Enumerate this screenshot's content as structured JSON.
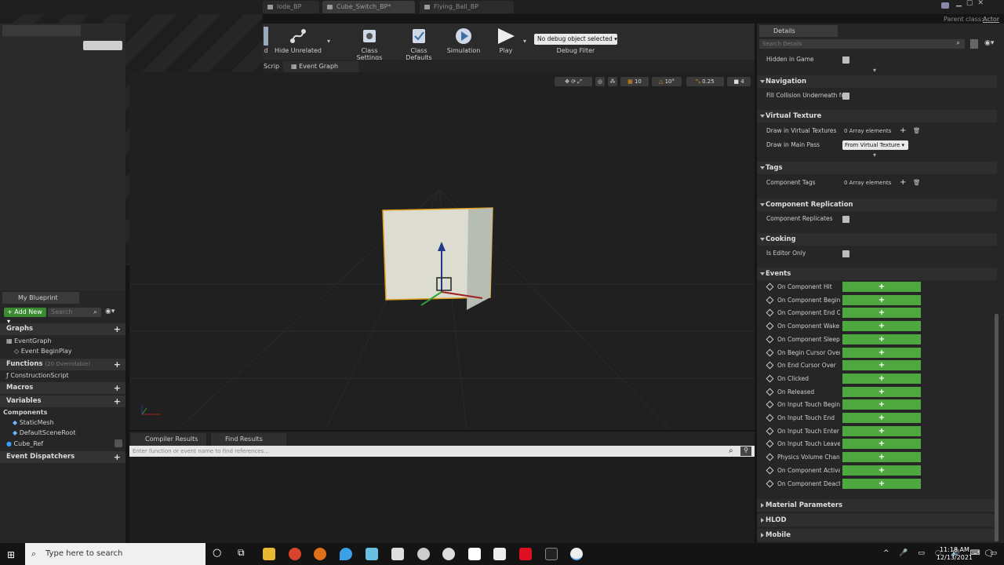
{
  "document_tabs": [
    {
      "label": "lode_BP",
      "active": false
    },
    {
      "label": "Cube_Switch_BP*",
      "active": true
    },
    {
      "label": "Flying_Ball_BP",
      "active": false
    }
  ],
  "parent_class": {
    "label": "Parent class:",
    "value": "Actor"
  },
  "toolbar": {
    "compile_partial": "d",
    "hide_unrelated": "Hide Unrelated",
    "class_settings": "Class Settings",
    "class_defaults": "Class Defaults",
    "simulation": "Simulation",
    "play": "Play",
    "debug_select": "No debug object selected",
    "debug_filter": "Debug Filter"
  },
  "graph_tabs": {
    "construction_partial": "Scrip",
    "event_graph": "Event Graph"
  },
  "viewport_toolbar": {
    "grid_snap": "10",
    "rotate_snap": "10°",
    "scale_snap": "0.25",
    "camera_speed": "4"
  },
  "my_blueprint": {
    "tab": "My Blueprint",
    "add_new": "Add New",
    "search_placeholder": "Search",
    "graphs": "Graphs",
    "event_graph": "EventGraph",
    "begin_play": "Event BeginPlay",
    "functions": "Functions",
    "functions_sub": "(20 Overridable)",
    "construction_script": "ConstructionScript",
    "macros": "Macros",
    "variables": "Variables",
    "components": "Components",
    "static_mesh": "StaticMesh",
    "default_scene_root": "DefaultSceneRoot",
    "cube_ref": "Cube_Ref",
    "event_dispatchers": "Event Dispatchers"
  },
  "bottom_tabs": {
    "compiler": "Compiler Results",
    "find": "Find Results",
    "find_placeholder": "Enter function or event name to find references..."
  },
  "details": {
    "tab": "Details",
    "search_placeholder": "Search Details",
    "hidden_in_game": "Hidden in Game",
    "navigation": "Navigation",
    "fill_collision": "Fill Collision Underneath for",
    "virtual_texture": "Virtual Texture",
    "draw_in_vt": "Draw in Virtual Textures",
    "array_elements": "0 Array elements",
    "draw_main_pass": "Draw in Main Pass",
    "from_vt": "From Virtual Texture",
    "tags": "Tags",
    "component_tags": "Component Tags",
    "component_replication": "Component Replication",
    "component_replicates": "Component Replicates",
    "cooking": "Cooking",
    "is_editor_only": "Is Editor Only",
    "events": "Events",
    "event_list": [
      "On Component Hit",
      "On Component Begin O",
      "On Component End Ove",
      "On Component Wake",
      "On Component Sleep",
      "On Begin Cursor Over",
      "On End Cursor Over",
      "On Clicked",
      "On Released",
      "On Input Touch Begin",
      "On Input Touch End",
      "On Input Touch Enter",
      "On Input Touch Leave",
      "Physics Volume Change",
      "On Component Activate",
      "On Component Deactiv"
    ],
    "material_parameters": "Material Parameters",
    "hlod": "HLOD",
    "mobile": "Mobile"
  },
  "taskbar": {
    "search_placeholder": "Type here to search",
    "time": "11:18 AM",
    "date": "12/13/2021"
  }
}
